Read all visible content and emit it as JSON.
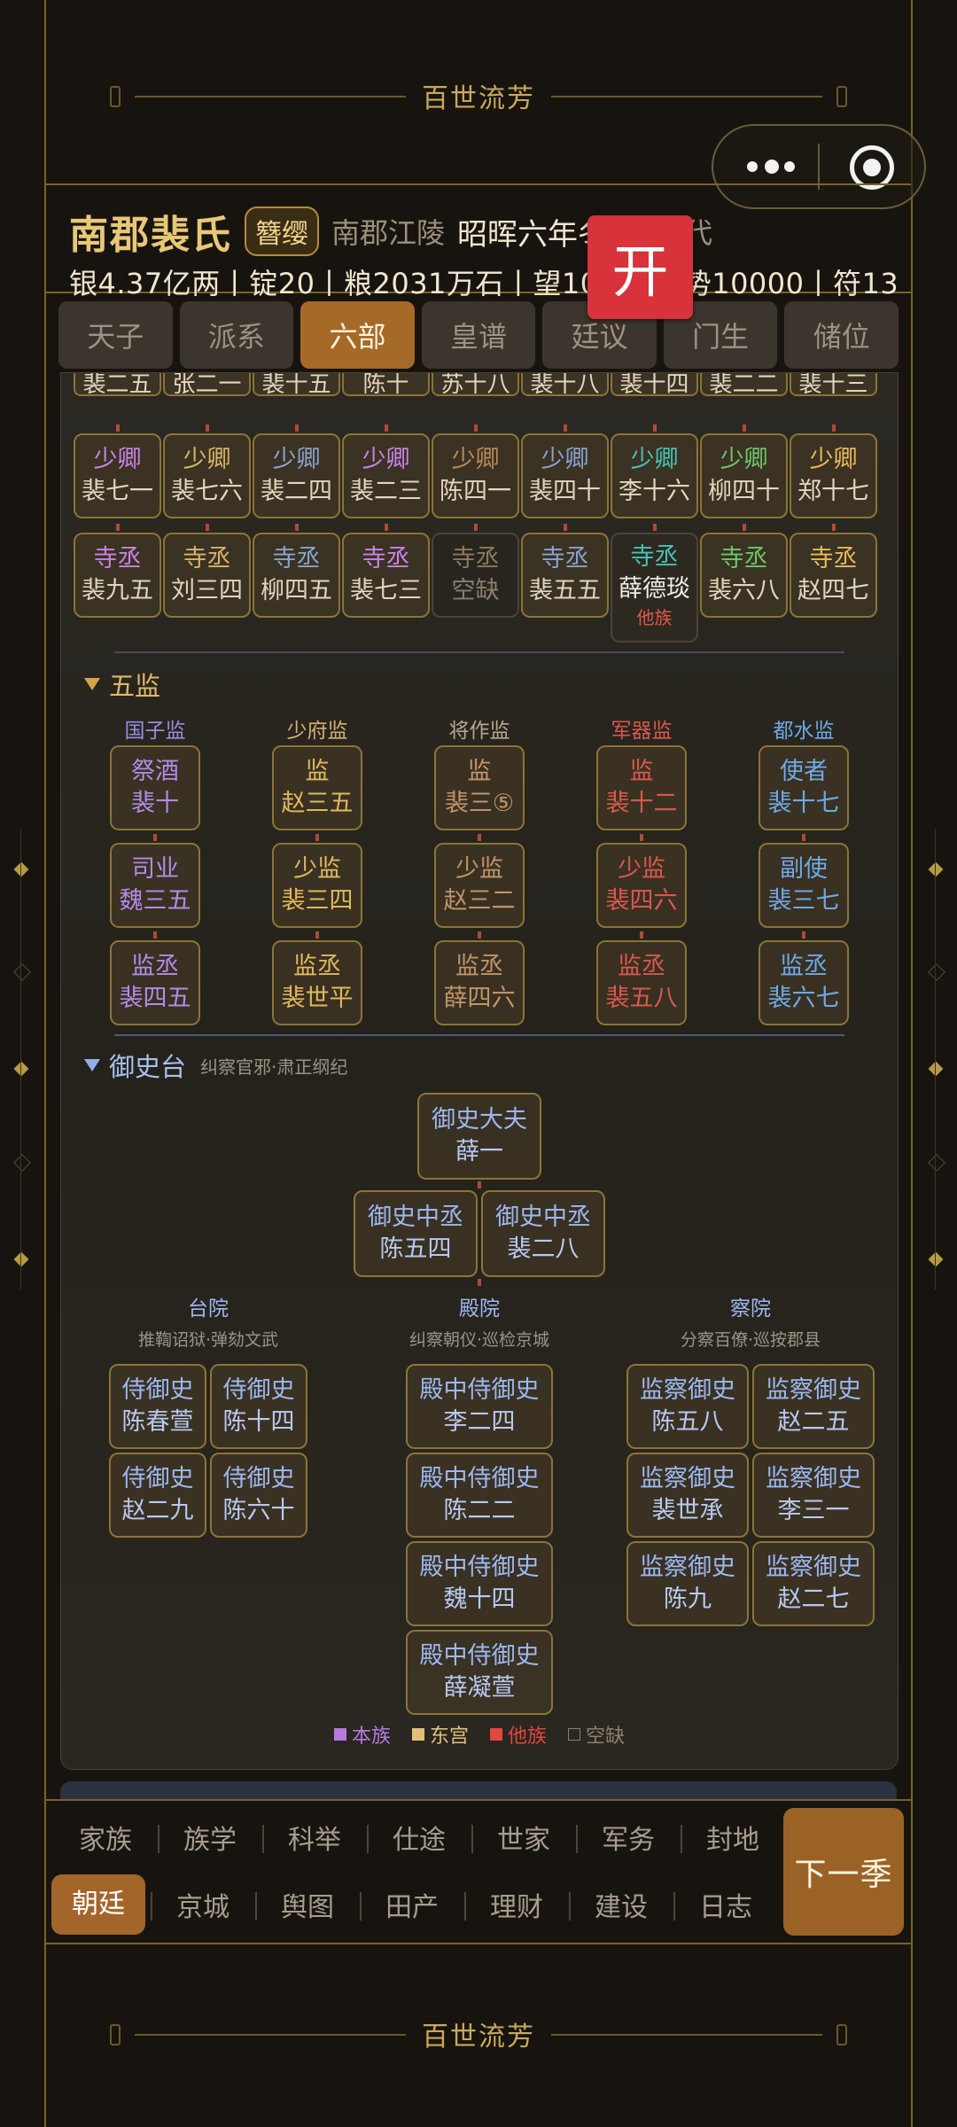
{
  "banner_title": "百世流芳",
  "header": {
    "clan": "南郡裴氏",
    "badge": "簪缨",
    "place": "南郡江陵",
    "era": "昭晖六年冬",
    "dynasty": "一代",
    "stats": "银4.37亿两丨锭20丨粮2031万石丨望10000丨势10000丨符13"
  },
  "open_button": "开",
  "tabs": [
    {
      "label": "天子",
      "active": false
    },
    {
      "label": "派系",
      "active": false
    },
    {
      "label": "六部",
      "active": true
    },
    {
      "label": "皇谱",
      "active": false
    },
    {
      "label": "廷议",
      "active": false
    },
    {
      "label": "门生",
      "active": false
    },
    {
      "label": "储位",
      "active": false
    }
  ],
  "temples": {
    "top_names": [
      "裴二五",
      "张二一",
      "裴十五",
      "陈十",
      "苏十八",
      "裴十八",
      "裴十四",
      "裴二二",
      "裴十三"
    ],
    "rows": [
      [
        {
          "title": "少卿",
          "name": "裴七一",
          "color": "#c983e6"
        },
        {
          "title": "少卿",
          "name": "裴七六",
          "color": "#d8b46c"
        },
        {
          "title": "少卿",
          "name": "裴二四",
          "color": "#8aa2cf"
        },
        {
          "title": "少卿",
          "name": "裴二三",
          "color": "#c983e6"
        },
        {
          "title": "少卿",
          "name": "陈四一",
          "color": "#b88a5a"
        },
        {
          "title": "少卿",
          "name": "裴四十",
          "color": "#8aa2cf"
        },
        {
          "title": "少卿",
          "name": "李十六",
          "color": "#46c2b8"
        },
        {
          "title": "少卿",
          "name": "柳四十",
          "color": "#6cc56c"
        },
        {
          "title": "少卿",
          "name": "郑十七",
          "color": "#e8b95a"
        }
      ],
      [
        {
          "title": "寺丞",
          "name": "裴九五",
          "color": "#c983e6"
        },
        {
          "title": "寺丞",
          "name": "刘三四",
          "color": "#d8b46c"
        },
        {
          "title": "寺丞",
          "name": "柳四五",
          "color": "#8aa2cf"
        },
        {
          "title": "寺丞",
          "name": "裴七三",
          "color": "#c983e6"
        },
        {
          "title": "寺丞",
          "name": "空缺",
          "color": "#8a7a60",
          "kind": "empty"
        },
        {
          "title": "寺丞",
          "name": "裴五五",
          "color": "#8aa2cf"
        },
        {
          "title": "寺丞",
          "name": "薛德琰",
          "color": "#46c2b8",
          "kind": "other",
          "tag": "他族"
        },
        {
          "title": "寺丞",
          "name": "裴六八",
          "color": "#6cc56c"
        },
        {
          "title": "寺丞",
          "name": "赵四七",
          "color": "#e8b95a"
        }
      ]
    ]
  },
  "wujian": {
    "heading": "五监",
    "columns": [
      {
        "label": "国子监",
        "color": "#9a8ce0",
        "cells": [
          {
            "title": "祭酒",
            "name": "裴十",
            "color": "#b28ae8"
          },
          {
            "title": "司业",
            "name": "魏三五",
            "color": "#b28ae8"
          },
          {
            "title": "监丞",
            "name": "裴四五",
            "color": "#b28ae8"
          }
        ]
      },
      {
        "label": "少府监",
        "color": "#d2b070",
        "cells": [
          {
            "title": "监",
            "name": "赵三五",
            "color": "#e0b95c"
          },
          {
            "title": "少监",
            "name": "裴三四",
            "color": "#e0b95c"
          },
          {
            "title": "监丞",
            "name": "裴世平",
            "color": "#e0b95c"
          }
        ]
      },
      {
        "label": "将作监",
        "color": "#b8a690",
        "cells": [
          {
            "title": "监",
            "name": "裴三⑤",
            "color": "#c09566"
          },
          {
            "title": "少监",
            "name": "赵三二",
            "color": "#c09566"
          },
          {
            "title": "监丞",
            "name": "薛四六",
            "color": "#c09566"
          }
        ]
      },
      {
        "label": "军器监",
        "color": "#d8594e",
        "cells": [
          {
            "title": "监",
            "name": "裴十二",
            "color": "#d9584c"
          },
          {
            "title": "少监",
            "name": "裴四六",
            "color": "#d9584c"
          },
          {
            "title": "监丞",
            "name": "裴五八",
            "color": "#d9584c"
          }
        ]
      },
      {
        "label": "都水监",
        "color": "#6fa8e6",
        "cells": [
          {
            "title": "使者",
            "name": "裴十七",
            "color": "#6fa8e6"
          },
          {
            "title": "副使",
            "name": "裴三七",
            "color": "#6fa8e6"
          },
          {
            "title": "监丞",
            "name": "裴六七",
            "color": "#6fa8e6"
          }
        ]
      }
    ]
  },
  "yushitai": {
    "heading": "御史台",
    "desc": "纠察官邪·肃正纲纪",
    "chief": {
      "title": "御史大夫",
      "name": "薛一"
    },
    "deputies": [
      {
        "title": "御史中丞",
        "name": "陈五四"
      },
      {
        "title": "御史中丞",
        "name": "裴二八"
      }
    ],
    "courts": [
      {
        "label": "台院",
        "desc": "推鞫诏狱·弹劾文武",
        "cells": [
          {
            "title": "侍御史",
            "name": "陈春萱"
          },
          {
            "title": "侍御史",
            "name": "陈十四"
          },
          {
            "title": "侍御史",
            "name": "赵二九"
          },
          {
            "title": "侍御史",
            "name": "陈六十"
          }
        ]
      },
      {
        "label": "殿院",
        "desc": "纠察朝仪·巡检京城",
        "cells": [
          {
            "title": "殿中侍御史",
            "name": "李二四"
          },
          {
            "title": "殿中侍御史",
            "name": "陈二二"
          },
          {
            "title": "殿中侍御史",
            "name": "魏十四"
          },
          {
            "title": "殿中侍御史",
            "name": "薛凝萱"
          }
        ]
      },
      {
        "label": "察院",
        "desc": "分察百僚·巡按郡县",
        "cells": [
          {
            "title": "监察御史",
            "name": "陈五八"
          },
          {
            "title": "监察御史",
            "name": "赵二五"
          },
          {
            "title": "监察御史",
            "name": "裴世承"
          },
          {
            "title": "监察御史",
            "name": "李三一"
          },
          {
            "title": "监察御史",
            "name": "陈九"
          },
          {
            "title": "监察御史",
            "name": "赵二七"
          }
        ]
      }
    ]
  },
  "legend": [
    {
      "label": "本族",
      "color": "#b57be0"
    },
    {
      "label": "东宫",
      "color": "#e2c07a"
    },
    {
      "label": "他族",
      "color": "#e0473e"
    },
    {
      "label": "空缺",
      "color": "#8a8070"
    }
  ],
  "bottom_nav": {
    "row1": [
      "家族",
      "族学",
      "科举",
      "仕途",
      "世家",
      "军务",
      "封地"
    ],
    "row2": [
      "朝廷",
      "京城",
      "舆图",
      "田产",
      "理财",
      "建设",
      "日志"
    ],
    "row2_active": "朝廷",
    "next_label": "下一季"
  },
  "colors": {
    "gold": "#c9a95a",
    "accent": "#a66a28",
    "frame": "#7a6226",
    "open_red": "#d8323a"
  }
}
